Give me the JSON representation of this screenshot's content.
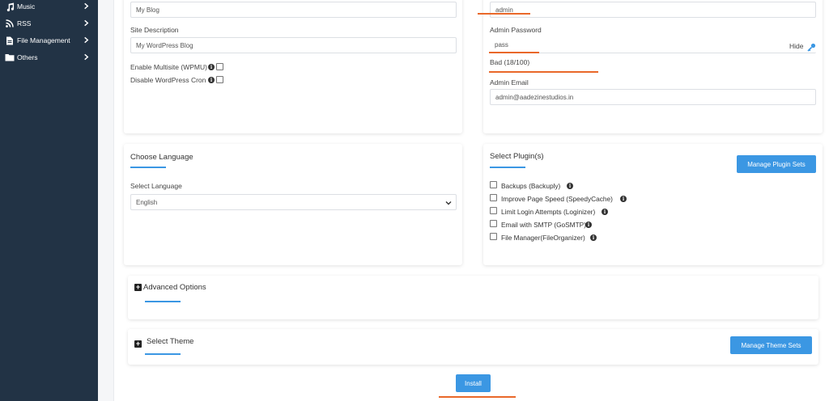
{
  "sidebar": {
    "items": [
      {
        "label": "Music",
        "icon": "music-icon"
      },
      {
        "label": "RSS",
        "icon": "rss-icon"
      },
      {
        "label": "File Management",
        "icon": "file-icon"
      },
      {
        "label": "Others",
        "icon": "folder-icon"
      }
    ]
  },
  "site": {
    "name_value": "My Blog",
    "description_label": "Site Description",
    "description_value": "My WordPress Blog",
    "multisite_label": "Enable Multisite (WPMU)",
    "cron_label": "Disable WordPress Cron"
  },
  "admin": {
    "username_value": "admin",
    "password_label": "Admin Password",
    "password_value": "pass",
    "hide_label": "Hide",
    "strength_label": "Bad (18/100)",
    "email_label": "Admin Email",
    "email_value": "admin@aadezinestudios.in"
  },
  "language": {
    "heading": "Choose Language",
    "select_label": "Select Language",
    "selected": "English"
  },
  "plugins": {
    "heading": "Select Plugin(s)",
    "manage_button": "Manage Plugin Sets",
    "items": [
      "Backups (Backuply)",
      "Improve Page Speed (SpeedyCache)",
      "Limit Login Attempts (Loginizer)",
      "Email with SMTP (GoSMTP)",
      "File Manager(FileOrganizer)"
    ]
  },
  "advanced": {
    "heading": "Advanced Options"
  },
  "theme": {
    "heading": "Select Theme",
    "manage_button": "Manage Theme Sets"
  },
  "install_button": "Install",
  "colors": {
    "sidebar_bg": "#223345",
    "accent_blue": "#3b97e3",
    "highlight_orange": "#e9682a"
  }
}
